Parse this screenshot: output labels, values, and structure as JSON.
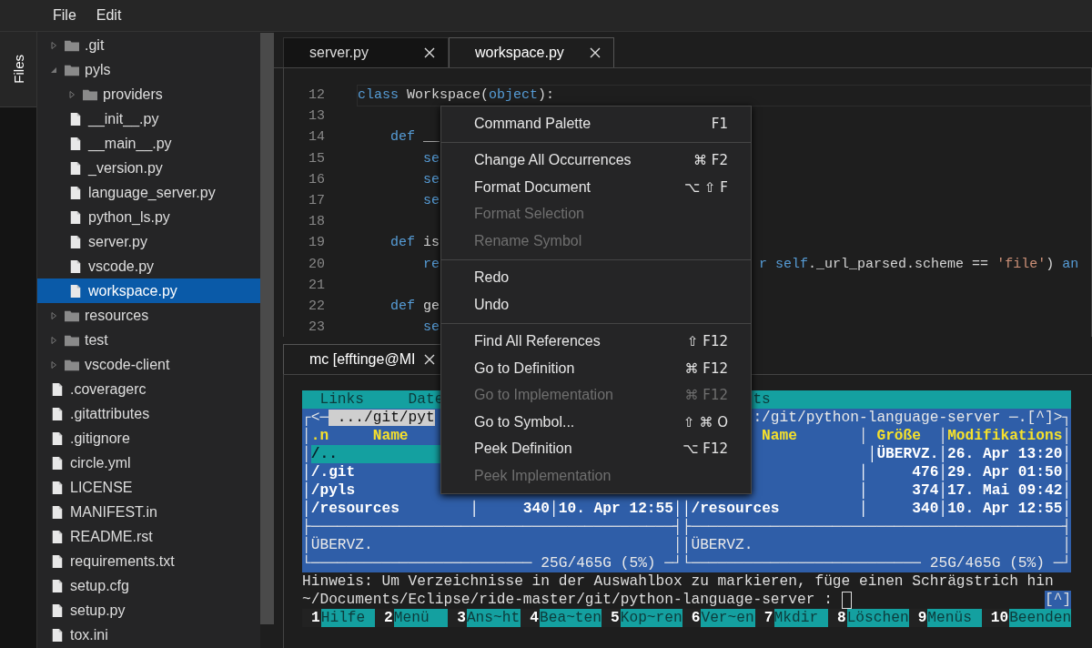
{
  "menubar": [
    "File",
    "Edit"
  ],
  "activity": {
    "label": "Files",
    "selected": true
  },
  "tree": [
    {
      "name": ".git",
      "kind": "folder",
      "expanded": false,
      "selected": false
    },
    {
      "name": "pyls",
      "kind": "folder",
      "expanded": true,
      "selected": false,
      "children": [
        {
          "name": "providers",
          "kind": "folder",
          "expanded": false,
          "selected": false
        },
        {
          "name": "__init__.py",
          "kind": "file",
          "selected": false
        },
        {
          "name": "__main__.py",
          "kind": "file",
          "selected": false
        },
        {
          "name": "_version.py",
          "kind": "file",
          "selected": false
        },
        {
          "name": "language_server.py",
          "kind": "file",
          "selected": false
        },
        {
          "name": "python_ls.py",
          "kind": "file",
          "selected": false
        },
        {
          "name": "server.py",
          "kind": "file",
          "selected": false
        },
        {
          "name": "vscode.py",
          "kind": "file",
          "selected": false
        },
        {
          "name": "workspace.py",
          "kind": "file",
          "selected": true
        }
      ]
    },
    {
      "name": "resources",
      "kind": "folder",
      "expanded": false,
      "selected": false
    },
    {
      "name": "test",
      "kind": "folder",
      "expanded": false,
      "selected": false
    },
    {
      "name": "vscode-client",
      "kind": "folder",
      "expanded": false,
      "selected": false
    },
    {
      "name": ".coveragerc",
      "kind": "file",
      "selected": false
    },
    {
      "name": ".gitattributes",
      "kind": "file",
      "selected": false
    },
    {
      "name": ".gitignore",
      "kind": "file",
      "selected": false
    },
    {
      "name": "circle.yml",
      "kind": "file",
      "selected": false
    },
    {
      "name": "LICENSE",
      "kind": "file",
      "selected": false
    },
    {
      "name": "MANIFEST.in",
      "kind": "file",
      "selected": false
    },
    {
      "name": "README.rst",
      "kind": "file",
      "selected": false
    },
    {
      "name": "requirements.txt",
      "kind": "file",
      "selected": false
    },
    {
      "name": "setup.cfg",
      "kind": "file",
      "selected": false
    },
    {
      "name": "setup.py",
      "kind": "file",
      "selected": false
    },
    {
      "name": "tox.ini",
      "kind": "file",
      "selected": false
    }
  ],
  "editor_tabs": [
    {
      "label": "server.py",
      "selected": false
    },
    {
      "label": "workspace.py",
      "selected": true
    }
  ],
  "code": [
    {
      "number": "12",
      "current": true,
      "left": [
        {
          "text": "class",
          "kind": "kw"
        },
        {
          "text": " Workspace(",
          "kind": "plain"
        },
        {
          "text": "object",
          "kind": "kw"
        },
        {
          "text": "):",
          "kind": "plain"
        }
      ]
    },
    {
      "number": "13",
      "current": false
    },
    {
      "number": "14",
      "current": false,
      "left": [
        {
          "text": "    def",
          "kind": "kw"
        },
        {
          "text": " __",
          "kind": "plain"
        }
      ]
    },
    {
      "number": "15",
      "current": false,
      "left": [
        {
          "text": "        se",
          "kind": "kw"
        }
      ]
    },
    {
      "number": "16",
      "current": false,
      "left": [
        {
          "text": "        se",
          "kind": "kw"
        }
      ]
    },
    {
      "number": "17",
      "current": false,
      "left": [
        {
          "text": "        se",
          "kind": "kw"
        }
      ]
    },
    {
      "number": "18",
      "current": false
    },
    {
      "number": "19",
      "current": false,
      "left": [
        {
          "text": "    def",
          "kind": "kw"
        },
        {
          "text": " is",
          "kind": "plain"
        }
      ]
    },
    {
      "number": "20",
      "current": false,
      "left": [
        {
          "text": "        re",
          "kind": "kw"
        }
      ],
      "right": [
        {
          "text": "r self",
          "kind": "kw"
        },
        {
          "text": "._url_parsed.scheme == ",
          "kind": "plain"
        },
        {
          "text": "'file'",
          "kind": "str"
        },
        {
          "text": ") ",
          "kind": "plain"
        },
        {
          "text": "an",
          "kind": "kw"
        }
      ]
    },
    {
      "number": "21",
      "current": false
    },
    {
      "number": "22",
      "current": false,
      "left": [
        {
          "text": "    def",
          "kind": "kw"
        },
        {
          "text": " ge",
          "kind": "plain"
        }
      ]
    },
    {
      "number": "23",
      "current": false,
      "left": [
        {
          "text": "        se",
          "kind": "kw"
        }
      ]
    }
  ],
  "terminal_tab": {
    "label": "mc [efftinge@MI",
    "selected": true
  },
  "mc_rows": [
    {
      "kind": "menubar",
      "left": [
        {
          "text": "  Links     Date",
          "kind": "bar"
        }
      ],
      "right": [
        {
          "text": "ts",
          "kind": "bar"
        }
      ]
    },
    {
      "kind": "panel",
      "left": [
        {
          "text": "┌<─",
          "kind": "frame"
        },
        {
          "text": " .../git/pyt",
          "kind": "path"
        }
      ],
      "right": [
        {
          "text": ":/git/python-language-server ─.[^]>┐",
          "kind": "frame"
        }
      ]
    },
    {
      "kind": "panel",
      "left": [
        {
          "text": "│",
          "kind": "frame"
        },
        {
          "text": ".n     Name",
          "kind": "header"
        }
      ],
      "right": [
        {
          "text": " Name",
          "kind": "header"
        },
        {
          "text": "       │ ",
          "kind": "frame"
        },
        {
          "text": "Größe",
          "kind": "header"
        },
        {
          "text": "  │",
          "kind": "frame"
        },
        {
          "text": "Modifikations",
          "kind": "header"
        },
        {
          "text": "│",
          "kind": "frame"
        }
      ]
    },
    {
      "kind": "panel",
      "left": [
        {
          "text": "│",
          "kind": "frame"
        },
        {
          "text": "/..",
          "kind": "selected"
        }
      ],
      "right": [
        {
          "text": "             │ÜBERVZ.│26. Apr 13:20│",
          "kind": "dir"
        }
      ]
    },
    {
      "kind": "panel",
      "left": [
        {
          "text": "│/.git",
          "kind": "dir"
        }
      ],
      "right": [
        {
          "text": "            │     476│29. Apr 01:50│",
          "kind": "dir"
        }
      ]
    },
    {
      "kind": "panel",
      "left": [
        {
          "text": "│/pyls",
          "kind": "dir"
        }
      ],
      "right": [
        {
          "text": "            │     374│17. Mai 09:42│",
          "kind": "dir"
        }
      ]
    },
    {
      "kind": "panel",
      "left": [
        {
          "text": "│/resources        │     340│10. Apr 12:55││/resources         │     340│10. Apr 12:55│",
          "kind": "dir"
        }
      ]
    },
    {
      "kind": "panel",
      "left": [
        {
          "text": "├─────────────────────────────────────────┤├──────────────────────────────────────────┤",
          "kind": "frame"
        }
      ]
    },
    {
      "kind": "panel",
      "left": [
        {
          "text": "│ÜBERVZ.                                  ││ÜBERVZ.                                   │",
          "kind": "frame"
        }
      ]
    },
    {
      "kind": "panel",
      "left": [
        {
          "text": "└───────────────────────── 25G/465G (5%) ─┘└────────────────────────── 25G/465G (5%) ─┘",
          "kind": "frame"
        }
      ]
    }
  ],
  "hint": "Hinweis: Um Verzeichnisse in der Auswahlbox zu markieren, füge einen Schrägstrich hin",
  "prompt": {
    "text": "~/Documents/Eclipse/ride-master/git/python-language-server :",
    "indicator": "[^]"
  },
  "function_keys": [
    {
      "number": "1",
      "label": "Hilfe"
    },
    {
      "number": "2",
      "label": "Menü"
    },
    {
      "number": "3",
      "label": "Ans~ht"
    },
    {
      "number": "4",
      "label": "Bea~ten"
    },
    {
      "number": "5",
      "label": "Kop~ren"
    },
    {
      "number": "6",
      "label": "Ver~en"
    },
    {
      "number": "7",
      "label": "Mkdir"
    },
    {
      "number": "8",
      "label": "Löschen"
    },
    {
      "number": "9",
      "label": "Menüs"
    },
    {
      "number": "10",
      "label": "Beenden"
    }
  ],
  "context_menu": {
    "groups": [
      {
        "items": [
          {
            "label": "Command Palette",
            "shortcut": "F1",
            "disabled": false
          }
        ]
      },
      {
        "items": [
          {
            "label": "Change All Occurrences",
            "shortcut": "⌘ F2",
            "disabled": false
          },
          {
            "label": "Format Document",
            "shortcut": "⌥ ⇧ F",
            "disabled": false
          },
          {
            "label": "Format Selection",
            "disabled": true
          },
          {
            "label": "Rename Symbol",
            "disabled": true
          }
        ]
      },
      {
        "items": [
          {
            "label": "Redo",
            "disabled": false
          },
          {
            "label": "Undo",
            "disabled": false
          }
        ]
      },
      {
        "items": [
          {
            "label": "Find All References",
            "shortcut": "⇧ F12",
            "disabled": false
          },
          {
            "label": "Go to Definition",
            "shortcut": "⌘ F12",
            "disabled": false
          },
          {
            "label": "Go to Implementation",
            "shortcut": "⌘ F12",
            "disabled": true
          },
          {
            "label": "Go to Symbol...",
            "shortcut": "⇧ ⌘ O",
            "disabled": false
          },
          {
            "label": "Peek Definition",
            "shortcut": "⌥ F12",
            "disabled": false
          },
          {
            "label": "Peek Implementation",
            "disabled": true
          }
        ]
      }
    ]
  }
}
